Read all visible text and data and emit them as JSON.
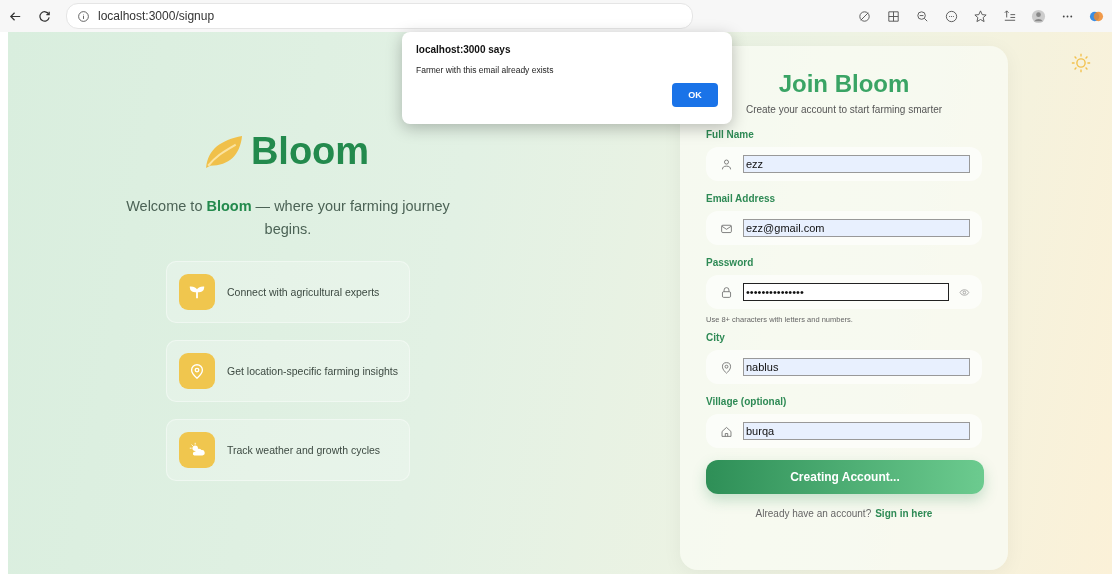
{
  "browser": {
    "url": "localhost:3000/signup"
  },
  "alert": {
    "title": "localhost:3000 says",
    "message": "Farmer with this email already exists",
    "button": "OK"
  },
  "brand": {
    "name": "Bloom"
  },
  "welcome": "Welcome to **Bloom** — where your farming journey begins.",
  "features": [
    {
      "kind": "sprout",
      "text": "Connect with agricultural experts"
    },
    {
      "kind": "location",
      "text": "Get location-specific farming insights"
    },
    {
      "kind": "weather",
      "text": "Track weather and growth cycles"
    }
  ],
  "form": {
    "title": "Join Bloom",
    "subtitle": "Create your account to start farming smarter",
    "fields": [
      {
        "label": "Full Name",
        "kind": "name",
        "value": "ezz",
        "focused": false
      },
      {
        "label": "Email Address",
        "kind": "email",
        "value": "ezz@gmail.com",
        "focused": false
      },
      {
        "label": "Password",
        "kind": "password",
        "value": "•••••••••••••••",
        "focused": true,
        "hint": "Use 8+ characters with letters and numbers."
      },
      {
        "label": "City",
        "kind": "city",
        "value": "nablus",
        "focused": false
      },
      {
        "label": "Village (optional)",
        "kind": "village",
        "value": "burqa",
        "focused": false
      }
    ],
    "submit": "Creating Account...",
    "footer_text": "Already have an account?",
    "footer_link": "Sign in here"
  }
}
